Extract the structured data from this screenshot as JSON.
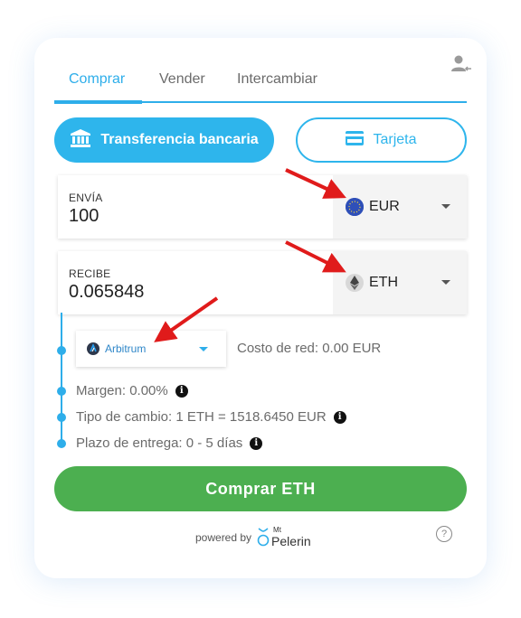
{
  "tabs": [
    {
      "label": "Comprar",
      "active": true
    },
    {
      "label": "Vender",
      "active": false
    },
    {
      "label": "Intercambiar",
      "active": false
    }
  ],
  "payment_methods": {
    "bank_label": "Transferencia bancaria",
    "card_label": "Tarjeta"
  },
  "send": {
    "label": "ENVÍA",
    "value": "100",
    "currency": "EUR"
  },
  "receive": {
    "label": "RECIBE",
    "value": "0.065848",
    "currency": "ETH"
  },
  "network": {
    "name": "Arbitrum",
    "fee": "Costo de red: 0.00 EUR"
  },
  "details": {
    "margin": "Margen: 0.00%",
    "rate": "Tipo de cambio: 1 ETH = 1518.6450 EUR",
    "delivery": "Plazo de entrega: 0 - 5 días"
  },
  "buy_button": "Comprar ETH",
  "footer": {
    "powered_by": "powered by",
    "brand_top": "Mt",
    "brand_name": "Pelerin",
    "help": "?"
  },
  "colors": {
    "accent": "#2eaeea",
    "buy": "#4caf50",
    "annotation": "#e01b1b"
  },
  "icons": [
    "user-settings-icon",
    "bank-icon",
    "card-icon",
    "euro-coin-icon",
    "eth-coin-icon",
    "arbitrum-icon",
    "info-icon",
    "help-icon",
    "mt-pelerin-logo"
  ]
}
